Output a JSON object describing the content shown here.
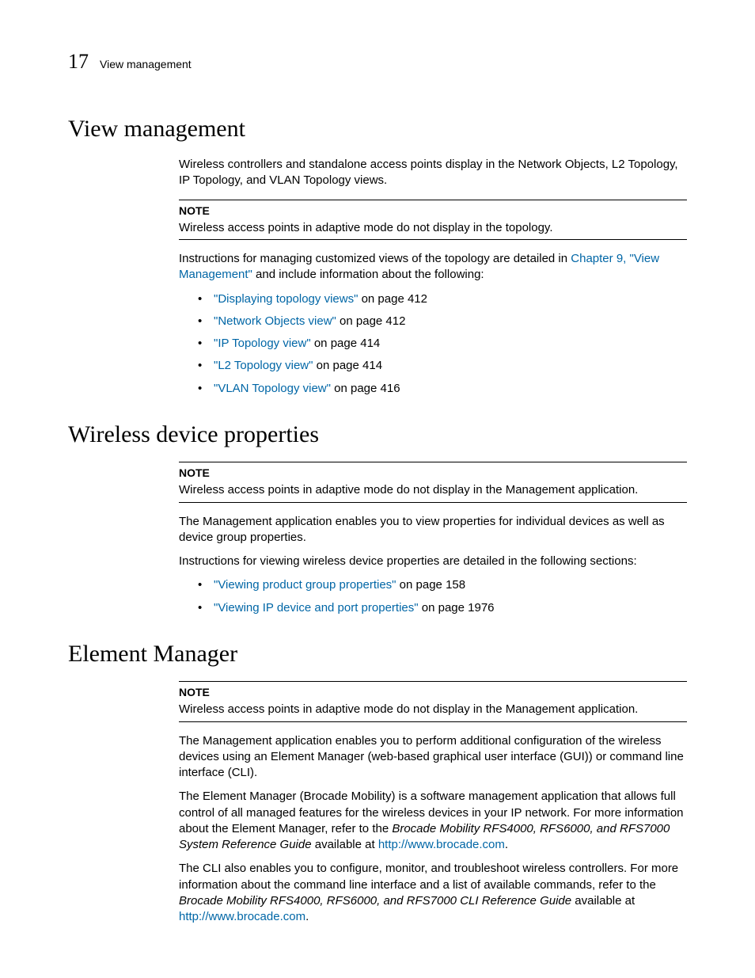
{
  "runhead": {
    "chapter_number": "17",
    "chapter_title": "View management"
  },
  "sections": {
    "view_management": {
      "heading": "View management",
      "intro": "Wireless controllers and standalone access points display in the Network Objects, L2 Topology, IP Topology, and VLAN Topology views.",
      "note_label": "NOTE",
      "note_text": "Wireless access points in adaptive mode do not display in the topology.",
      "instr_pre": "Instructions for managing customized views of the topology are detailed in ",
      "instr_link": "Chapter 9, \"View Management\"",
      "instr_post": " and include information about the following:",
      "bullets": [
        {
          "link": "\"Displaying topology views\"",
          "tail": " on page 412"
        },
        {
          "link": "\"Network Objects view\"",
          "tail": " on page 412"
        },
        {
          "link": "\"IP Topology view\"",
          "tail": " on page 414"
        },
        {
          "link": "\"L2 Topology view\"",
          "tail": " on page 414"
        },
        {
          "link": "\"VLAN Topology view\"",
          "tail": " on page 416"
        }
      ]
    },
    "wireless_props": {
      "heading": "Wireless device properties",
      "note_label": "NOTE",
      "note_text": "Wireless access points in adaptive mode do not display in the Management application.",
      "para1": "The Management application enables you to view properties for individual devices as well as device group properties.",
      "para2": "Instructions for viewing wireless device properties are detailed in the following sections:",
      "bullets": [
        {
          "link": "\"Viewing product group properties\"",
          "tail": " on page 158"
        },
        {
          "link": "\"Viewing IP device and port properties\"",
          "tail": " on page 1976"
        }
      ]
    },
    "element_manager": {
      "heading": "Element Manager",
      "note_label": "NOTE",
      "note_text": "Wireless access points in adaptive mode do not display in the Management application.",
      "para1": "The Management application enables you to perform additional configuration of the wireless devices using an Element Manager (web-based graphical user interface (GUI)) or command line interface (CLI).",
      "para2_pre": "The Element Manager (Brocade Mobility) is a software management application that allows full control of all managed features for the wireless devices in your IP network.  For more information about the Element Manager, refer to the ",
      "para2_em": "Brocade Mobility RFS4000, RFS6000, and RFS7000 System Reference Guide",
      "para2_mid": " available at ",
      "para2_link": "http://www.brocade.com",
      "para2_end": ".",
      "para3_pre": "The CLI also enables you to configure, monitor, and troubleshoot wireless controllers. For more information about the command line interface and a list of available commands, refer to the ",
      "para3_em": "Brocade Mobility RFS4000, RFS6000, and RFS7000 CLI Reference Guide",
      "para3_mid": " available at ",
      "para3_link": "http://www.brocade.com",
      "para3_end": "."
    }
  }
}
